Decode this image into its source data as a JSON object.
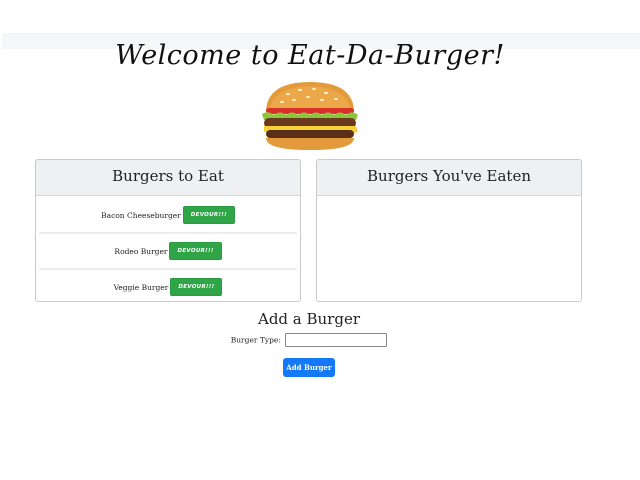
{
  "header": {
    "title": "Welcome to Eat-Da-Burger!"
  },
  "to_eat": {
    "heading": "Burgers to Eat",
    "items": [
      {
        "name": "Bacon Cheeseburger",
        "button": "DEVOUR!!!"
      },
      {
        "name": "Rodeo Burger",
        "button": "DEVOUR!!!"
      },
      {
        "name": "Veggie Burger",
        "button": "DEVOUR!!!"
      }
    ]
  },
  "eaten": {
    "heading": "Burgers You've Eaten",
    "items": []
  },
  "add_form": {
    "heading": "Add a Burger",
    "label": "Burger Type:",
    "input_value": "",
    "input_placeholder": "",
    "button": "Add Burger"
  },
  "colors": {
    "devour_button": "#2fa548",
    "add_button": "#1479f6",
    "card_header_bg": "#eff0f1"
  }
}
